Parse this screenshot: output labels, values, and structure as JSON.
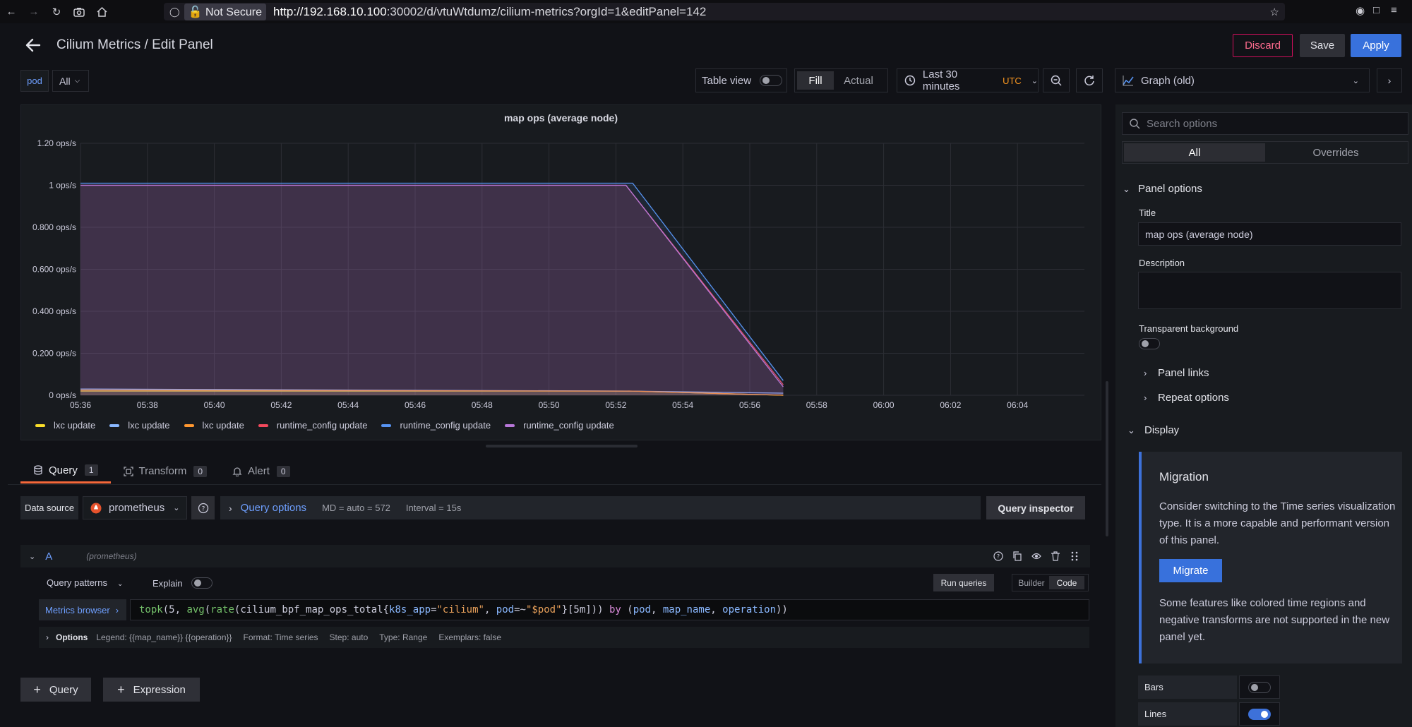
{
  "browser": {
    "not_secure": "Not Secure",
    "url_host": "http://192.168.10.100",
    "url_path": ":30002/d/vtuWtdumz/cilium-metrics?orgId=1&editPanel=142"
  },
  "header": {
    "title": "Cilium Metrics / Edit Panel",
    "discard": "Discard",
    "save": "Save",
    "apply": "Apply"
  },
  "toolbar": {
    "var_label": "pod",
    "var_value": "All",
    "table_view": "Table view",
    "fill": "Fill",
    "actual": "Actual",
    "time_range": "Last 30 minutes",
    "timezone": "UTC",
    "visualization": "Graph (old)"
  },
  "panel": {
    "title": "map ops (average node)"
  },
  "chart_data": {
    "type": "area",
    "title": "map ops (average node)",
    "x_ticks": [
      "05:36",
      "05:38",
      "05:40",
      "05:42",
      "05:44",
      "05:46",
      "05:48",
      "05:50",
      "05:52",
      "05:54",
      "05:56",
      "05:58",
      "06:00",
      "06:02",
      "06:04"
    ],
    "y_ticks": [
      "0 ops/s",
      "0.200 ops/s",
      "0.400 ops/s",
      "0.600 ops/s",
      "0.800 ops/s",
      "1 ops/s",
      "1.20 ops/s"
    ],
    "ylim": [
      0,
      1.2
    ],
    "xlim_minutes": [
      0,
      30
    ],
    "legend_position": "bottom",
    "grid": true,
    "series": [
      {
        "name": "lxc update",
        "color": "#fade2a",
        "x": [
          0,
          16.5,
          21
        ],
        "y": [
          0.02,
          0.02,
          0.0
        ]
      },
      {
        "name": "lxc update",
        "color": "#8ab8ff",
        "x": [
          0,
          16.5,
          21
        ],
        "y": [
          0.03,
          0.02,
          0.01
        ]
      },
      {
        "name": "lxc update",
        "color": "#ff9830",
        "x": [
          0,
          16.5,
          21
        ],
        "y": [
          0.025,
          0.02,
          0.0
        ]
      },
      {
        "name": "runtime_config update",
        "color": "#f2495c",
        "x": [
          0,
          16.3,
          21
        ],
        "y": [
          1.0,
          1.0,
          0.05
        ]
      },
      {
        "name": "runtime_config update",
        "color": "#5794f2",
        "x": [
          0,
          16.5,
          21
        ],
        "y": [
          1.01,
          1.01,
          0.07
        ]
      },
      {
        "name": "runtime_config update",
        "color": "#b877d9",
        "x": [
          0,
          16.3,
          21
        ],
        "y": [
          1.0,
          1.0,
          0.04
        ]
      }
    ]
  },
  "query_tabs": {
    "query": "Query",
    "query_count": "1",
    "transform": "Transform",
    "transform_count": "0",
    "alert": "Alert",
    "alert_count": "0"
  },
  "datasource": {
    "label": "Data source",
    "name": "prometheus",
    "options_title": "Query options",
    "md": "MD = auto = 572",
    "interval": "Interval = 15s",
    "inspector": "Query inspector"
  },
  "query_a": {
    "ref": "A",
    "ds_hint": "(prometheus)",
    "patterns": "Query patterns",
    "explain": "Explain",
    "run": "Run queries",
    "builder": "Builder",
    "code": "Code",
    "metrics_browser": "Metrics browser",
    "expr": {
      "p1": "topk",
      "p2": "(5, ",
      "p3": "avg",
      "p4": "(",
      "p5": "rate",
      "p6": "(cilium_bpf_map_ops_total{",
      "p7": "k8s_app",
      "p8": "=",
      "p9": "\"cilium\"",
      "p10": ", ",
      "p11": "pod",
      "p12": "=~",
      "p13": "\"$pod\"",
      "p14": "}[5m])) ",
      "p15": "by",
      "p16": " (",
      "p17": "pod",
      "p18": ", ",
      "p19": "map_name",
      "p20": ", ",
      "p21": "operation",
      "p22": "))"
    },
    "options_title": "Options",
    "legend": "Legend: {{map_name}} {{operation}}",
    "format": "Format: Time series",
    "step": "Step: auto",
    "qtype": "Type: Range",
    "exemplars": "Exemplars: false"
  },
  "add": {
    "query": "Query",
    "expression": "Expression"
  },
  "options_pane": {
    "search_placeholder": "Search options",
    "tab_all": "All",
    "tab_overrides": "Overrides",
    "panel_options": "Panel options",
    "title_label": "Title",
    "title_value": "map ops (average node)",
    "description_label": "Description",
    "transparent_label": "Transparent background",
    "panel_links": "Panel links",
    "repeat_options": "Repeat options",
    "display": "Display",
    "migration_title": "Migration",
    "migration_text1": "Consider switching to the Time series visualization type. It is a more capable and performant version of this panel.",
    "migrate": "Migrate",
    "migration_text2": "Some features like colored time regions and negative transforms are not supported in the new panel yet.",
    "bars": "Bars",
    "lines": "Lines"
  }
}
